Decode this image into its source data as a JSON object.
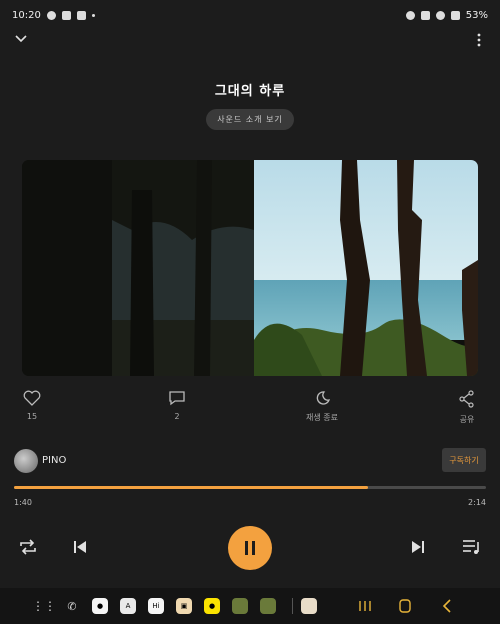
{
  "status": {
    "time": "10:20",
    "battery": "53%"
  },
  "song": {
    "title": "그대의 하루",
    "intro_label": "사운드 소개 보기"
  },
  "actions": {
    "like_count": "15",
    "comment_count": "2",
    "sleep_label": "재생 종료",
    "share_label": "공유"
  },
  "artist": {
    "name": "PINO",
    "subscribe_label": "구독하기"
  },
  "playback": {
    "elapsed": "1:40",
    "duration": "2:14",
    "progress": 0.75
  },
  "colors": {
    "accent": "#f3a13f",
    "background": "#1c1c1c"
  },
  "nav": {
    "apps": [
      "apps-grid-icon",
      "phone-icon",
      "chat-icon",
      "translate-icon",
      "hi-icon",
      "tv-icon",
      "kakao-icon",
      "folder-icon",
      "folder2-icon",
      "gallery-icon"
    ],
    "buttons": [
      "recents-icon",
      "home-icon",
      "back-icon"
    ]
  }
}
